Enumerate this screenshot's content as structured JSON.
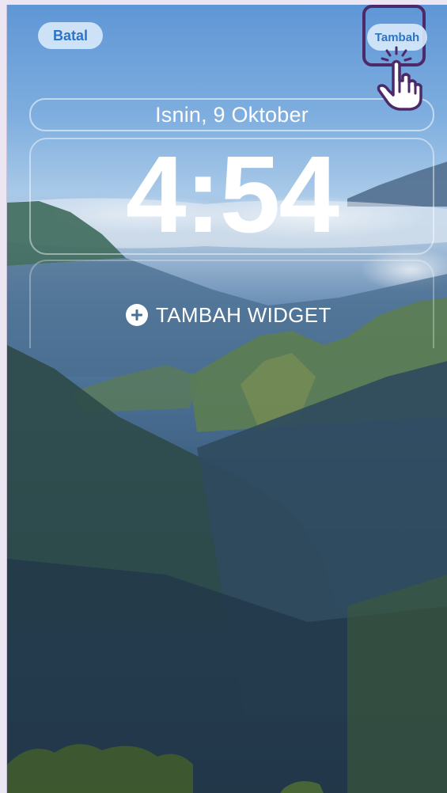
{
  "top_bar": {
    "cancel_label": "Batal",
    "add_label": "Tambah"
  },
  "lock_screen": {
    "date": "Isnin, 9 Oktober",
    "time": "4:54",
    "add_widget_label": "TAMBAH WIDGET"
  },
  "icons": {
    "add_widget": "plus-circle-icon",
    "pointer": "hand-pointer-icon"
  },
  "colors": {
    "button_text": "#2b74c7",
    "button_bg": "#d6e8fa",
    "highlight_border": "#4c2a6a",
    "clock_text": "#ffffff"
  }
}
